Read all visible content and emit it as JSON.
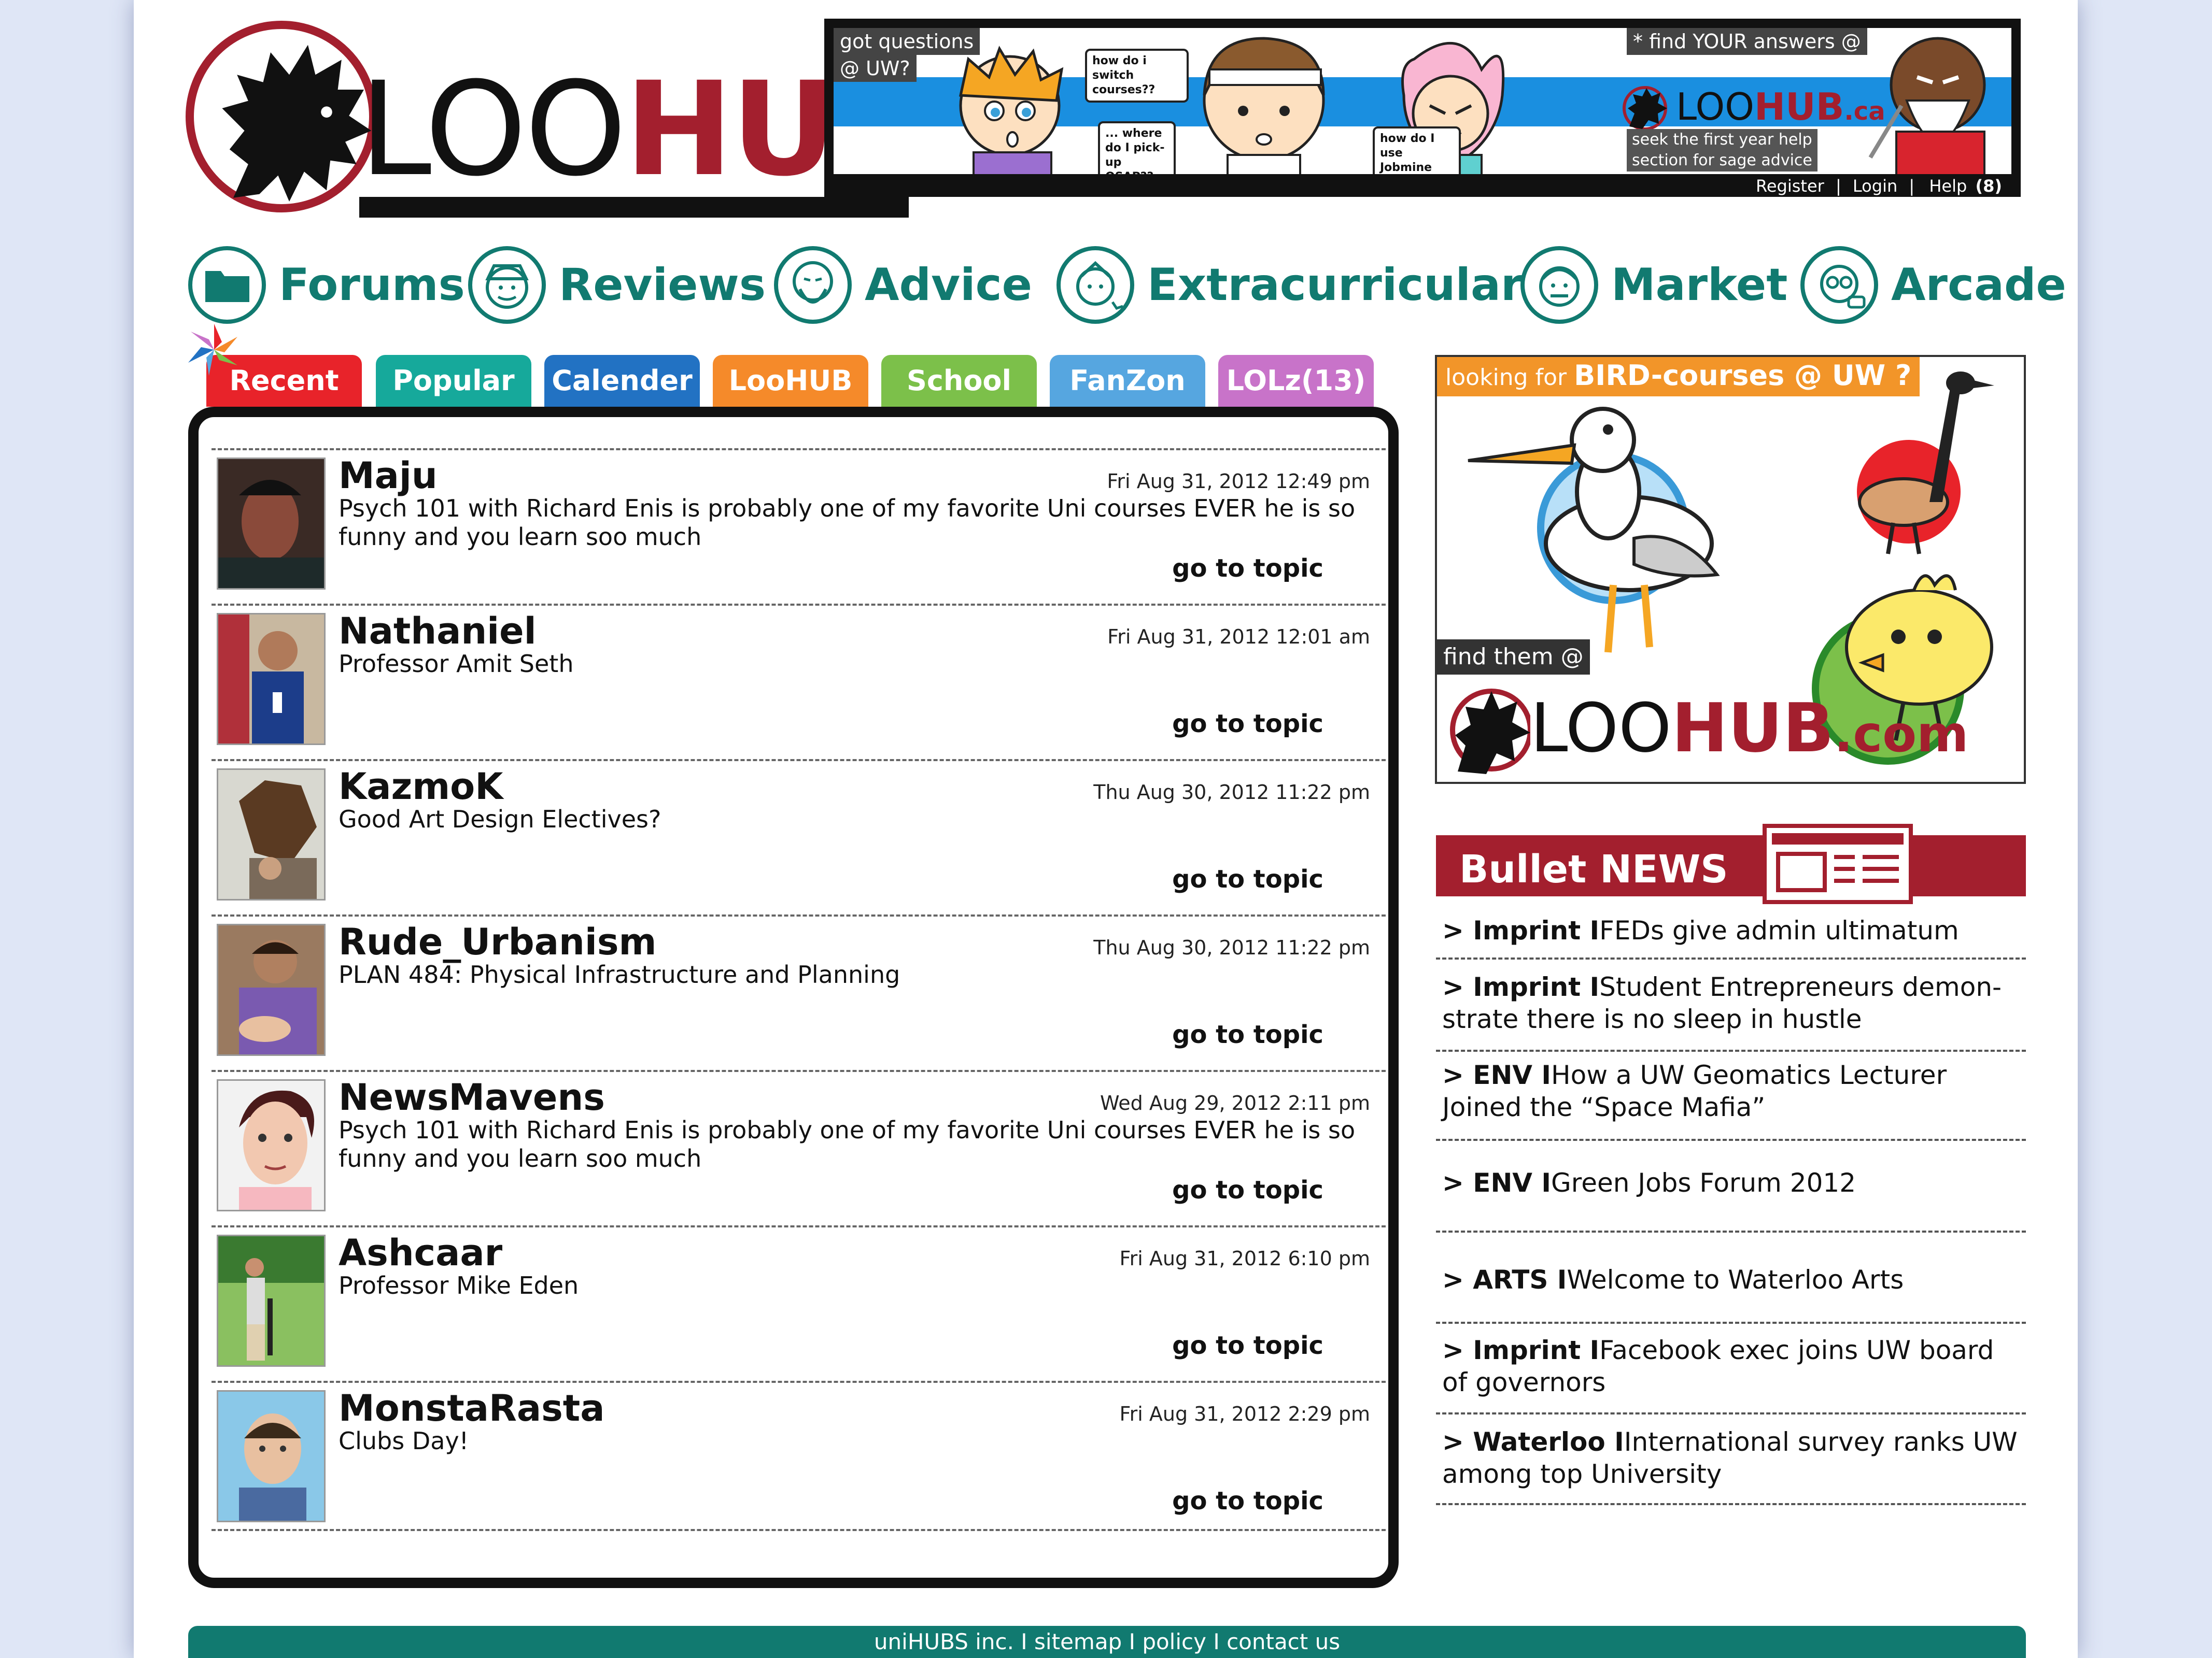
{
  "logo": {
    "loo": "LOO",
    "hub": "HUB"
  },
  "banner": {
    "tag_left_1": "got questions",
    "tag_left_2": "@ UW?",
    "bubble_1": "how do i switch courses??",
    "bubble_2": "... where do I pick-up OSAP??",
    "bubble_3": "how do I use Jobmine ?!?",
    "tag_right": "* find YOUR answers @",
    "mini_logo_loo": "LOO",
    "mini_logo_hub": "HUB",
    "mini_logo_ca": ".ca",
    "sage_1": "seek the first year help",
    "sage_2": "section for sage advice",
    "links": {
      "register": "Register",
      "sep": "|",
      "login": "Login",
      "help": "Help",
      "help_count": "(8)"
    }
  },
  "mainnav": [
    {
      "label": "Forums",
      "icon": "folder-icon"
    },
    {
      "label": "Reviews",
      "icon": "reviewer-face-icon"
    },
    {
      "label": "Advice",
      "icon": "sage-face-icon"
    },
    {
      "label": "Extracurricular",
      "icon": "student-face-icon"
    },
    {
      "label": "Market",
      "icon": "merchant-face-icon"
    },
    {
      "label": "Arcade",
      "icon": "gamer-face-icon"
    }
  ],
  "tabs": [
    {
      "label": "Recent",
      "color": "#e8232a"
    },
    {
      "label": "Popular",
      "color": "#16a99b"
    },
    {
      "label": "Calender",
      "color": "#2272c3"
    },
    {
      "label": "LooHUB",
      "color": "#f58a2a"
    },
    {
      "label": "School",
      "color": "#7cc04a"
    },
    {
      "label": "FanZon",
      "color": "#56a6e0"
    },
    {
      "label": "LOLz(13)",
      "color": "#c873c9"
    }
  ],
  "topics": [
    {
      "name": "Maju",
      "date": "Fri Aug 31, 2012 12:49 pm",
      "text": "Psych 101 with Richard Enis is probably one of my favorite Uni courses EVER he is so funny and you learn soo much",
      "link": "go to topic"
    },
    {
      "name": "Nathaniel",
      "date": "Fri Aug 31, 2012 12:01 am",
      "text": "Professor Amit Seth",
      "link": "go to topic"
    },
    {
      "name": "KazmoK",
      "date": "Thu Aug 30, 2012 11:22 pm",
      "text": "Good Art Design Electives?",
      "link": "go to topic"
    },
    {
      "name": "Rude_Urbanism",
      "date": "Thu Aug 30, 2012 11:22 pm",
      "text": "PLAN 484: Physical Infrastructure and Planning",
      "link": "go to topic"
    },
    {
      "name": "NewsMavens",
      "date": "Wed Aug 29, 2012 2:11 pm",
      "text": "Psych 101 with Richard Enis is probably one of my favorite Uni courses EVER he is so funny and you learn soo much",
      "link": "go to topic"
    },
    {
      "name": "Ashcaar",
      "date": "Fri Aug 31, 2012  6:10 pm",
      "text": "Professor Mike Eden",
      "link": "go to topic"
    },
    {
      "name": "MonstaRasta",
      "date": "Fri Aug 31, 2012  2:29 pm",
      "text": "Clubs Day!",
      "link": "go to topic"
    }
  ],
  "ad": {
    "head_pre": "looking for",
    "head_bold": "BIRD-courses @ UW ?",
    "find": "find them @",
    "logo_loo": "LOO",
    "logo_hub": "HUB",
    "logo_com": ".com"
  },
  "news": {
    "title": "Bullet NEWS",
    "items": [
      {
        "source": "> Imprint I",
        "text": "FEDs give admin ultimatum"
      },
      {
        "source": "> Imprint I",
        "text": "Student Entrepreneurs demon-strate there is no sleep in hustle"
      },
      {
        "source": "> ENV I",
        "text": "How a UW Geomatics Lecturer Joined the “Space Mafia”"
      },
      {
        "source": "> ENV I",
        "text": "Green Jobs Forum 2012"
      },
      {
        "source": "> ARTS I",
        "text": "Welcome to Waterloo Arts"
      },
      {
        "source": "> Imprint I",
        "text": "Facebook exec joins UW board of governors"
      },
      {
        "source": "> Waterloo I",
        "text": "International survey ranks UW among top University"
      }
    ]
  },
  "footer": {
    "company": "uniHUBS inc.",
    "sitemap": "sitemap",
    "policy": "policy",
    "contact": "contact us",
    "sep": " I "
  },
  "colors": {
    "teal": "#117a70",
    "brand_red": "#a31f2e",
    "ad_orange": "#f29529"
  }
}
